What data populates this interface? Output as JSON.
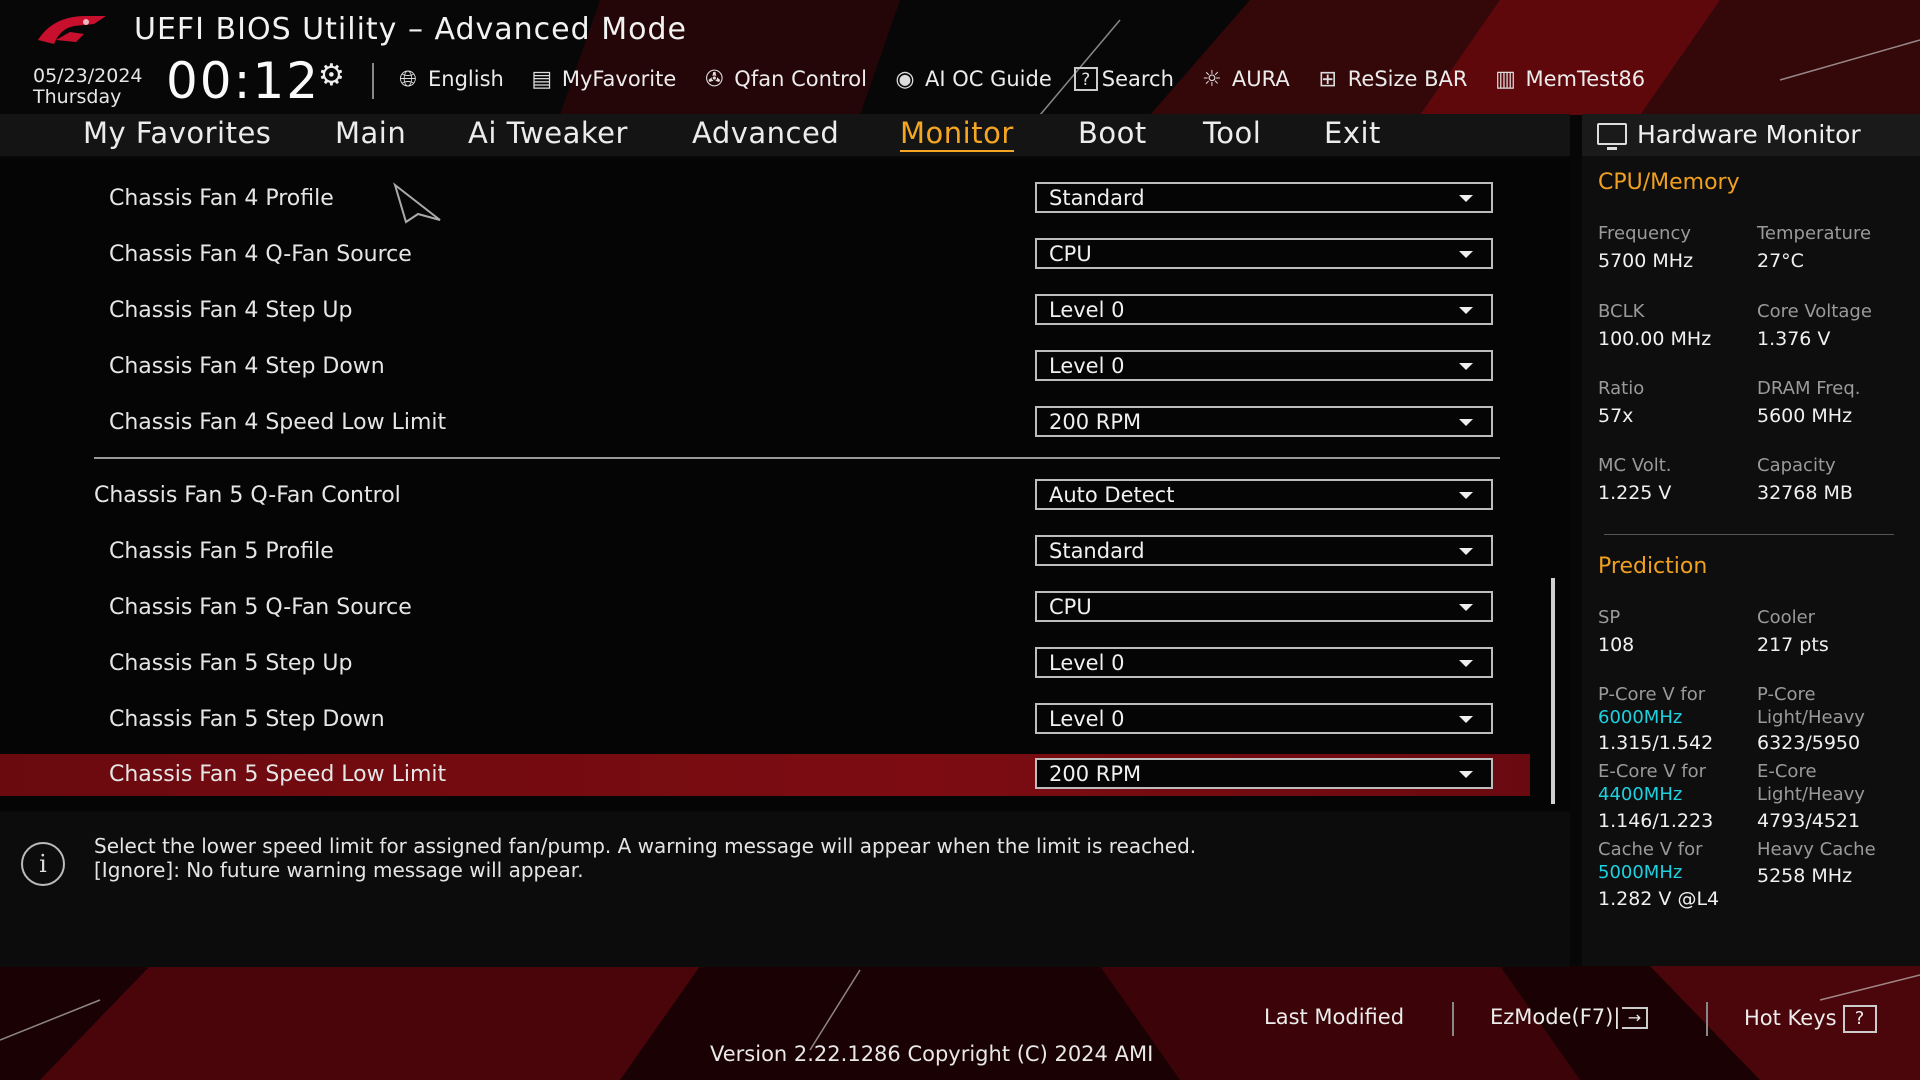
{
  "header": {
    "title": "UEFI BIOS Utility – Advanced Mode",
    "date": "05/23/2024",
    "weekday": "Thursday",
    "time": "00:12",
    "toolbar": [
      {
        "icon": "globe-icon",
        "label": "English"
      },
      {
        "icon": "favorite-list-icon",
        "label": "MyFavorite"
      },
      {
        "icon": "fan-icon",
        "label": "Qfan Control"
      },
      {
        "icon": "ai-oc-icon",
        "label": "AI OC Guide"
      },
      {
        "icon": "question-icon",
        "label": "Search"
      },
      {
        "icon": "aura-light-icon",
        "label": "AURA"
      },
      {
        "icon": "resize-bar-icon",
        "label": "ReSize BAR"
      },
      {
        "icon": "memory-icon",
        "label": "MemTest86"
      }
    ]
  },
  "nav": {
    "tabs": [
      {
        "label": "My Favorites"
      },
      {
        "label": "Main"
      },
      {
        "label": "Ai Tweaker"
      },
      {
        "label": "Advanced"
      },
      {
        "label": "Monitor",
        "active": true
      },
      {
        "label": "Boot"
      },
      {
        "label": "Tool"
      },
      {
        "label": "Exit"
      }
    ]
  },
  "settings": [
    {
      "label": "Chassis Fan 4 Profile",
      "value": "Standard"
    },
    {
      "label": "Chassis Fan 4 Q-Fan Source",
      "value": "CPU"
    },
    {
      "label": "Chassis Fan 4 Step Up",
      "value": "Level 0"
    },
    {
      "label": "Chassis Fan 4 Step Down",
      "value": "Level 0"
    },
    {
      "label": "Chassis Fan 4 Speed Low Limit",
      "value": "200 RPM"
    },
    {
      "label": "Chassis Fan 5 Q-Fan Control",
      "value": "Auto Detect"
    },
    {
      "label": "Chassis Fan 5 Profile",
      "value": "Standard"
    },
    {
      "label": "Chassis Fan 5 Q-Fan Source",
      "value": "CPU"
    },
    {
      "label": "Chassis Fan 5 Step Up",
      "value": "Level 0"
    },
    {
      "label": "Chassis Fan 5 Step Down",
      "value": "Level 0"
    },
    {
      "label": "Chassis Fan 5 Speed Low Limit",
      "value": "200 RPM",
      "selected": true
    }
  ],
  "help": {
    "line1": "Select the lower speed limit for assigned fan/pump. A warning message will appear when the limit is reached.",
    "line2": "[Ignore]: No future warning message will appear."
  },
  "hw_monitor": {
    "title": "Hardware Monitor",
    "cpu_memory": {
      "heading": "CPU/Memory",
      "frequency_label": "Frequency",
      "frequency": "5700 MHz",
      "temperature_label": "Temperature",
      "temperature": "27°C",
      "bclk_label": "BCLK",
      "bclk": "100.00 MHz",
      "core_voltage_label": "Core Voltage",
      "core_voltage": "1.376 V",
      "ratio_label": "Ratio",
      "ratio": "57x",
      "dram_freq_label": "DRAM Freq.",
      "dram_freq": "5600 MHz",
      "mc_volt_label": "MC Volt.",
      "mc_volt": "1.225 V",
      "capacity_label": "Capacity",
      "capacity": "32768 MB"
    },
    "prediction": {
      "heading": "Prediction",
      "sp_label": "SP",
      "sp": "108",
      "cooler_label": "Cooler",
      "cooler": "217 pts",
      "pcore_v_label": "P-Core V for",
      "pcore_v_freq": "6000MHz",
      "pcore_v": "1.315/1.542",
      "pcore_lh_label1": "P-Core",
      "pcore_lh_label2": "Light/Heavy",
      "pcore_lh": "6323/5950",
      "ecore_v_label": "E-Core V for",
      "ecore_v_freq": "4400MHz",
      "ecore_v": "1.146/1.223",
      "ecore_lh_label1": "E-Core",
      "ecore_lh_label2": "Light/Heavy",
      "ecore_lh": "4793/4521",
      "cache_v_label": "Cache V for",
      "cache_v_freq": "5000MHz",
      "cache_v": "1.282 V @L4",
      "heavy_cache_label": "Heavy Cache",
      "heavy_cache": "5258 MHz"
    }
  },
  "footer": {
    "last_modified": "Last Modified",
    "ezmode": "EzMode(F7)|",
    "hotkeys": "Hot Keys",
    "hotkeys_key": "?",
    "version": "Version 2.22.1286 Copyright (C) 2024 AMI"
  },
  "colors": {
    "accent": "#f5a623",
    "selection": "#7c0c12",
    "cyan": "#1fd0e0"
  }
}
